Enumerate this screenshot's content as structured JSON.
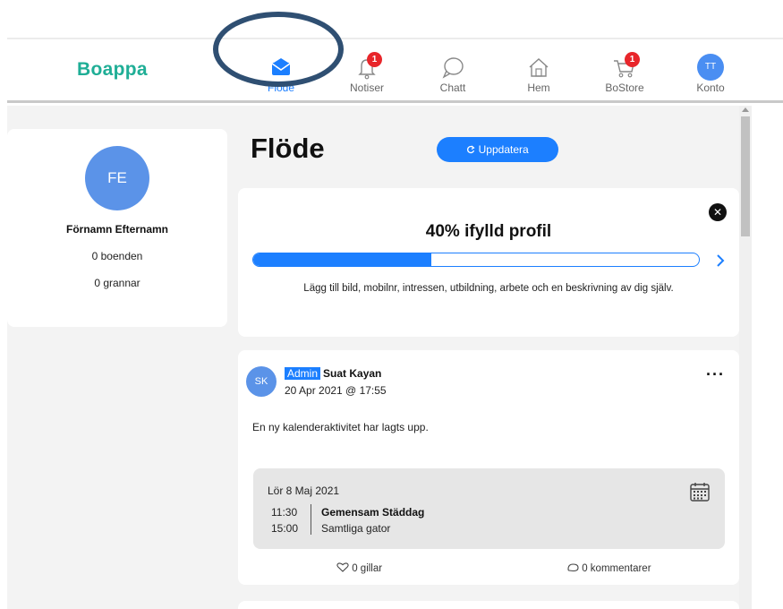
{
  "app": {
    "logo": "Boappa"
  },
  "nav": {
    "items": [
      {
        "id": "flode",
        "label": "Flöde",
        "icon": "mail-icon",
        "active": true
      },
      {
        "id": "notiser",
        "label": "Notiser",
        "icon": "bell-icon",
        "badge": "1"
      },
      {
        "id": "chatt",
        "label": "Chatt",
        "icon": "chat-bubble-icon"
      },
      {
        "id": "hem",
        "label": "Hem",
        "icon": "home-icon"
      },
      {
        "id": "bostore",
        "label": "BoStore",
        "icon": "cart-icon",
        "badge": "1"
      },
      {
        "id": "konto",
        "label": "Konto",
        "icon": "avatar",
        "avatar_initials": "TT"
      }
    ]
  },
  "sidebar": {
    "avatar_initials": "FE",
    "name": "Förnamn Efternamn",
    "residents": "0 boenden",
    "neighbors": "0 grannar"
  },
  "feed": {
    "title": "Flöde",
    "update_label": "Uppdatera",
    "update_icon": "refresh-icon"
  },
  "profile_card": {
    "heading": "40% ifylld profil",
    "progress_percent": 40,
    "description": "Lägg till bild, mobilnr, intressen, utbildning, arbete och en beskrivning av dig själv.",
    "close_icon": "close-icon",
    "next_icon": "chevron-right-icon"
  },
  "post": {
    "avatar_initials": "SK",
    "role_tag": "Admin",
    "author": "Suat Kayan",
    "date": "20 Apr 2021 @ 17:55",
    "text": "En ny kalenderaktivitet har lagts upp.",
    "event": {
      "date": "Lör 8 Maj 2021",
      "start_time": "11:30",
      "end_time": "15:00",
      "title": "Gemensam Städdag",
      "subtitle": "Samtliga gator",
      "icon": "calendar-icon"
    },
    "likes": "0 gillar",
    "comments": "0 kommentarer"
  },
  "colors": {
    "brand": "#1fae96",
    "accent": "#1c7fff",
    "badge": "#e8262b",
    "annotation": "#2f4f72"
  }
}
